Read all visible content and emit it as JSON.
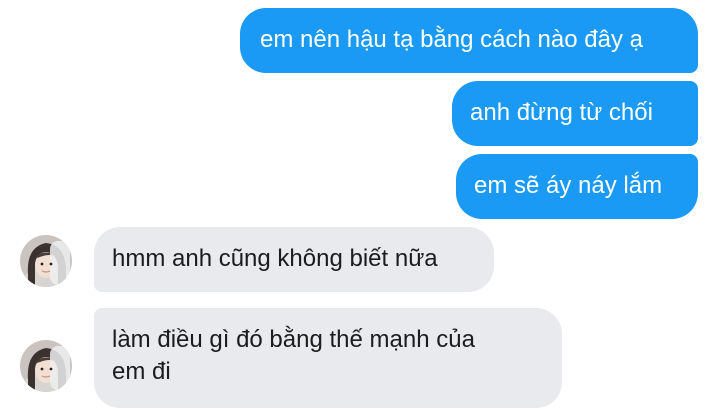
{
  "conversation": {
    "colors": {
      "sent_bubble": "#1a9af5",
      "sent_text": "#ffffff",
      "received_bubble": "#e8eaee",
      "received_text": "#1c1c1c"
    },
    "sent": [
      {
        "text": "em nên hậu tạ bằng cách nào đây ạ"
      },
      {
        "text": "anh đừng từ chối"
      },
      {
        "text": "em sẽ áy náy lắm"
      }
    ],
    "received": [
      {
        "text": "hmm anh cũng không biết nữa",
        "avatar": "contact-avatar-photo"
      },
      {
        "line1": "làm điều gì đó bằng thế mạnh của",
        "line2": "em đi",
        "avatar": "contact-avatar-photo"
      }
    ]
  }
}
